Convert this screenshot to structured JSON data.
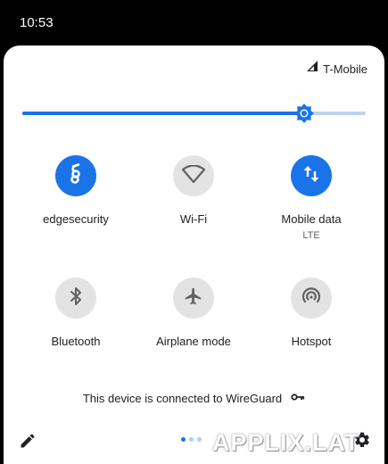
{
  "status_bar": {
    "time": "10:53"
  },
  "header": {
    "carrier": "T-Mobile",
    "signal_icon": "signal-icon"
  },
  "brightness": {
    "level": 0.82,
    "icon": "brightness-icon"
  },
  "tiles": [
    {
      "label": "edgesecurity",
      "state": "on",
      "icon": "wireguard-icon"
    },
    {
      "label": "Wi-Fi",
      "state": "off",
      "icon": "wifi-icon"
    },
    {
      "label": "Mobile data",
      "sublabel": "LTE",
      "state": "on",
      "icon": "mobile-data-icon"
    },
    {
      "label": "Bluetooth",
      "state": "off",
      "icon": "bluetooth-icon"
    },
    {
      "label": "Airplane mode",
      "state": "off",
      "icon": "airplane-icon"
    },
    {
      "label": "Hotspot",
      "state": "off",
      "icon": "hotspot-icon"
    }
  ],
  "vpn_notice": {
    "text": "This device is connected to WireGuard",
    "icon": "vpn-key-icon"
  },
  "footer": {
    "edit_icon": "edit-icon",
    "page_count": 3,
    "active_page": 1,
    "settings_icon": "settings-icon"
  },
  "watermark": "APPLIX.LAT",
  "colors": {
    "accent": "#1a73e8",
    "tile_off": "#e3e3e3",
    "text": "#202124",
    "subtext": "#5f6368"
  }
}
